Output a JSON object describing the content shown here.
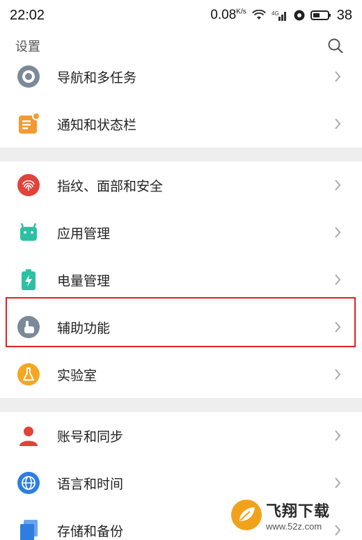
{
  "status_bar": {
    "time": "22:02",
    "net_speed": "0.08",
    "net_speed_unit": "K/s",
    "signal": "4G",
    "battery_level": "38"
  },
  "app_bar": {
    "title": "设置",
    "search_icon": "search-icon"
  },
  "groups": [
    {
      "items": [
        {
          "label": "导航和多任务",
          "icon": "navigation-icon",
          "color": "#7b8a99"
        },
        {
          "label": "通知和状态栏",
          "icon": "notification-icon",
          "color": "#f39a33"
        }
      ]
    },
    {
      "items": [
        {
          "label": "指纹、面部和安全",
          "icon": "fingerprint-icon",
          "color": "#e0433a"
        },
        {
          "label": "应用管理",
          "icon": "android-icon",
          "color": "#2dc1a3"
        },
        {
          "label": "电量管理",
          "icon": "battery-icon",
          "color": "#2dc1a3"
        },
        {
          "label": "辅助功能",
          "icon": "accessibility-icon",
          "color": "#7b8a99",
          "highlighted": true
        },
        {
          "label": "实验室",
          "icon": "flask-icon",
          "color": "#f5a623"
        }
      ]
    },
    {
      "items": [
        {
          "label": "账号和同步",
          "icon": "account-icon",
          "color": "#e0433a"
        },
        {
          "label": "语言和时间",
          "icon": "globe-icon",
          "color": "#2f7de1"
        },
        {
          "label": "存储和备份",
          "icon": "storage-icon",
          "color": "#2f7de1"
        }
      ]
    }
  ],
  "watermark": {
    "title": "飞翔下载",
    "url": "www.52z.com"
  },
  "colors": {
    "highlight": "#e02020",
    "divider": "#eeeeee"
  }
}
